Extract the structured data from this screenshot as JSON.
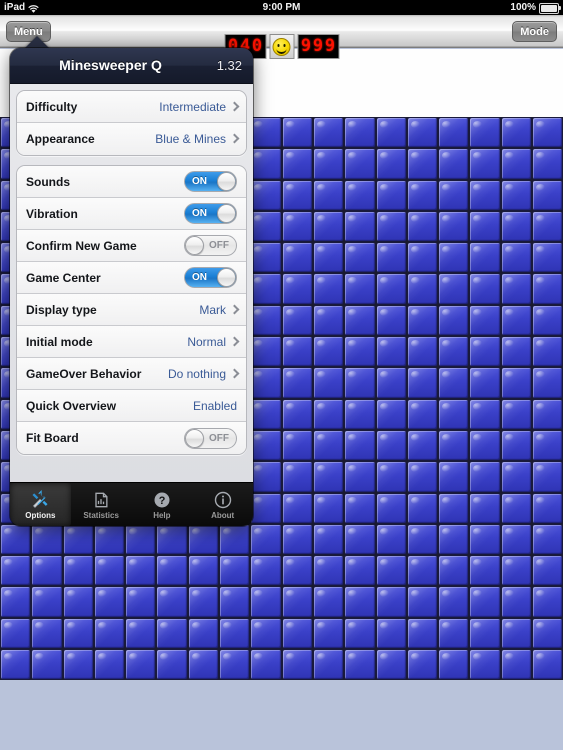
{
  "statusbar": {
    "device": "iPad",
    "wifi_icon": "wifi-icon",
    "time": "9:00 PM",
    "battery_percent": "100%",
    "battery_icon": "battery-icon"
  },
  "toolbar": {
    "menu_label": "Menu",
    "mode_label": "Mode",
    "mine_counter": "040",
    "timer_counter": "999",
    "face_icon": "smiley-face-icon"
  },
  "popover": {
    "title": "Minesweeper Q",
    "version": "1.32",
    "groups": [
      {
        "rows": [
          {
            "label": "Difficulty",
            "value": "Intermediate",
            "type": "disclosure"
          },
          {
            "label": "Appearance",
            "value": "Blue & Mines",
            "type": "disclosure"
          }
        ]
      },
      {
        "rows": [
          {
            "label": "Sounds",
            "value": "ON",
            "type": "toggle"
          },
          {
            "label": "Vibration",
            "value": "ON",
            "type": "toggle"
          },
          {
            "label": "Confirm New Game",
            "value": "OFF",
            "type": "toggle"
          },
          {
            "label": "Game Center",
            "value": "ON",
            "type": "toggle"
          },
          {
            "label": "Display type",
            "value": "Mark",
            "type": "disclosure"
          },
          {
            "label": "Initial mode",
            "value": "Normal",
            "type": "disclosure"
          },
          {
            "label": "GameOver Behavior",
            "value": "Do nothing",
            "type": "disclosure"
          },
          {
            "label": "Quick Overview",
            "value": "Enabled",
            "type": "plain"
          },
          {
            "label": "Fit Board",
            "value": "OFF",
            "type": "toggle"
          }
        ]
      }
    ],
    "tabs": [
      {
        "label": "Options",
        "icon": "wrench-screwdriver-icon",
        "selected": true
      },
      {
        "label": "Statistics",
        "icon": "chart-icon",
        "selected": false
      },
      {
        "label": "Help",
        "icon": "question-mark-icon",
        "selected": false
      },
      {
        "label": "About",
        "icon": "info-icon",
        "selected": false
      }
    ]
  },
  "board": {
    "columns": 18,
    "rows": 18,
    "tile_icon": "covered-tile",
    "tile_color": "#3a40c8"
  },
  "colors": {
    "accent_blue": "#1a7fd4",
    "value_text": "#3a5a96",
    "board_background": "#b9c3da",
    "counter_red": "#fc1100"
  }
}
